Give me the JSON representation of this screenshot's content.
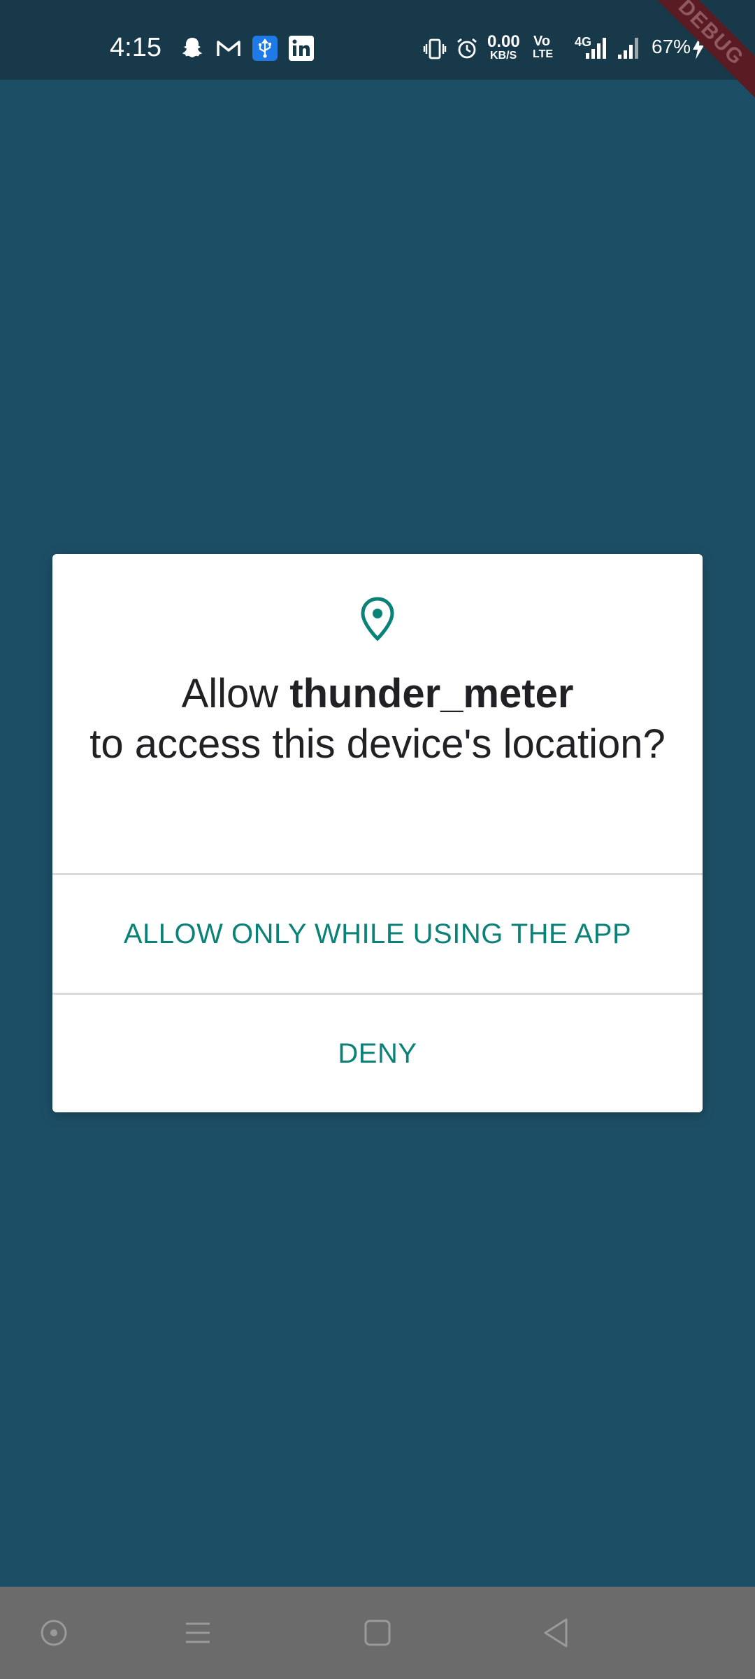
{
  "status_bar": {
    "time": "4:15",
    "network_speed_value": "0.00",
    "network_speed_unit": "KB/S",
    "volte_line1": "Vo",
    "volte_line2": "LTE",
    "network_type": "4G",
    "battery": "67%",
    "icons": [
      "snapchat-icon",
      "gmail-icon",
      "usb-icon",
      "linkedin-icon",
      "vibrate-icon",
      "alarm-icon",
      "signal-icon",
      "signal-icon-2",
      "charging-icon"
    ]
  },
  "debug_banner": "DEBUG",
  "dialog": {
    "icon": "location-pin-icon",
    "title_prefix": "Allow ",
    "app_name": "thunder_meter",
    "title_suffix": "to access this device's location?",
    "allow_button": "ALLOW ONLY WHILE USING THE APP",
    "deny_button": "DENY"
  },
  "nav_bar": {
    "icons": [
      "assistant-icon",
      "recents-icon",
      "home-icon",
      "back-icon"
    ]
  },
  "colors": {
    "background": "#1c4f66",
    "status_bar": "#17394a",
    "accent": "#0b8278",
    "nav_bar": "#6b6b6b"
  }
}
